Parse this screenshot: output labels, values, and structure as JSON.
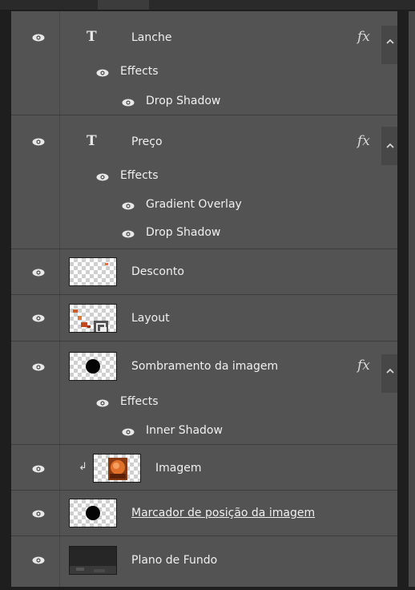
{
  "colors": {
    "panel": "#535353",
    "row_border": "#3d3d3d",
    "text": "#f0f0f0"
  },
  "layers": [
    {
      "name": "Lanche",
      "type_icon": "T",
      "fx": "fx",
      "effects_label": "Effects",
      "effects": [
        "Drop Shadow"
      ]
    },
    {
      "name": "Preço",
      "type_icon": "T",
      "fx": "fx",
      "effects_label": "Effects",
      "effects": [
        "Gradient Overlay",
        "Drop Shadow"
      ]
    },
    {
      "name": "Desconto"
    },
    {
      "name": "Layout"
    },
    {
      "name": "Sombramento da imagem",
      "fx": "fx",
      "effects_label": "Effects",
      "effects": [
        "Inner Shadow"
      ]
    },
    {
      "name": "Imagem",
      "clip_arrow": "↲"
    },
    {
      "name": "Marcador de posição da imagem"
    },
    {
      "name": "Plano de Fundo"
    }
  ]
}
